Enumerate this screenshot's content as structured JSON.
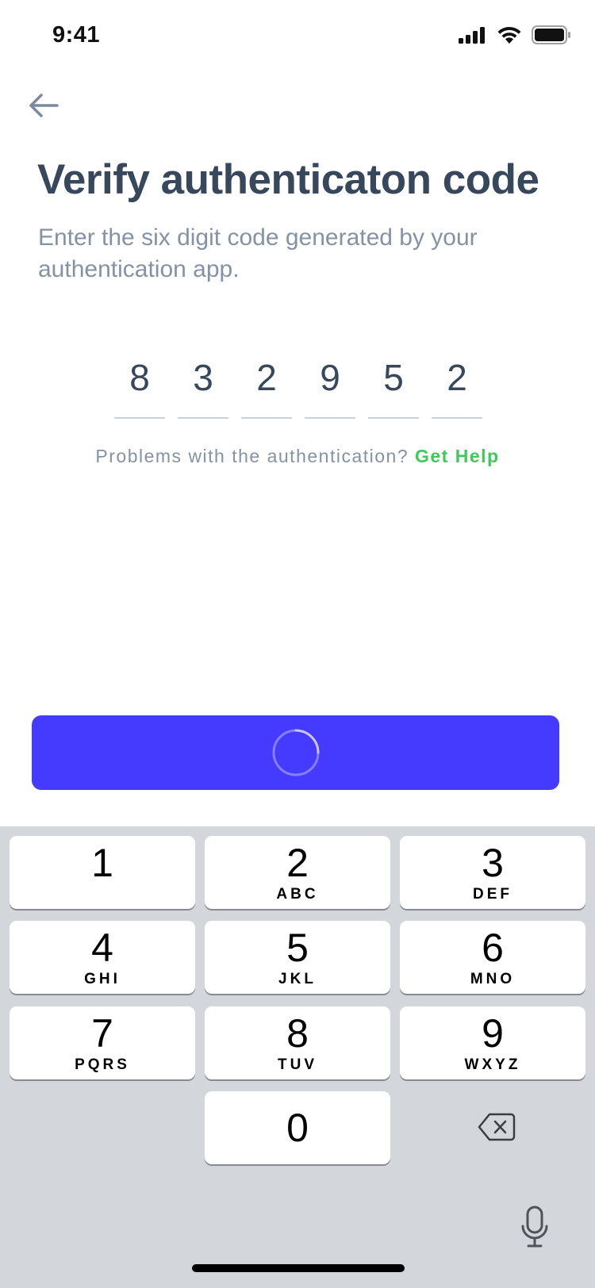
{
  "status_bar": {
    "time": "9:41"
  },
  "header": {
    "title": "Verify authenticaton code",
    "subtitle": "Enter the six digit code generated by your authentication app."
  },
  "code": {
    "digits": [
      "8",
      "3",
      "2",
      "9",
      "5",
      "2"
    ]
  },
  "help": {
    "text": "Problems with the authentication?",
    "link": "Get Help"
  },
  "primary_button": {
    "state": "loading"
  },
  "keyboard": {
    "keys": [
      {
        "num": "1",
        "letters": ""
      },
      {
        "num": "2",
        "letters": "ABC"
      },
      {
        "num": "3",
        "letters": "DEF"
      },
      {
        "num": "4",
        "letters": "GHI"
      },
      {
        "num": "5",
        "letters": "JKL"
      },
      {
        "num": "6",
        "letters": "MNO"
      },
      {
        "num": "7",
        "letters": "PQRS"
      },
      {
        "num": "8",
        "letters": "TUV"
      },
      {
        "num": "9",
        "letters": "WXYZ"
      },
      {
        "num": "0",
        "letters": ""
      }
    ]
  },
  "colors": {
    "accent": "#453bff",
    "link": "#3ec95a",
    "title": "#37475c",
    "muted": "#8492a6",
    "keyboard_bg": "#d3d6db"
  },
  "icons": [
    "back-arrow-icon",
    "signal-icon",
    "wifi-icon",
    "battery-icon",
    "spinner-icon",
    "backspace-icon",
    "microphone-icon"
  ]
}
